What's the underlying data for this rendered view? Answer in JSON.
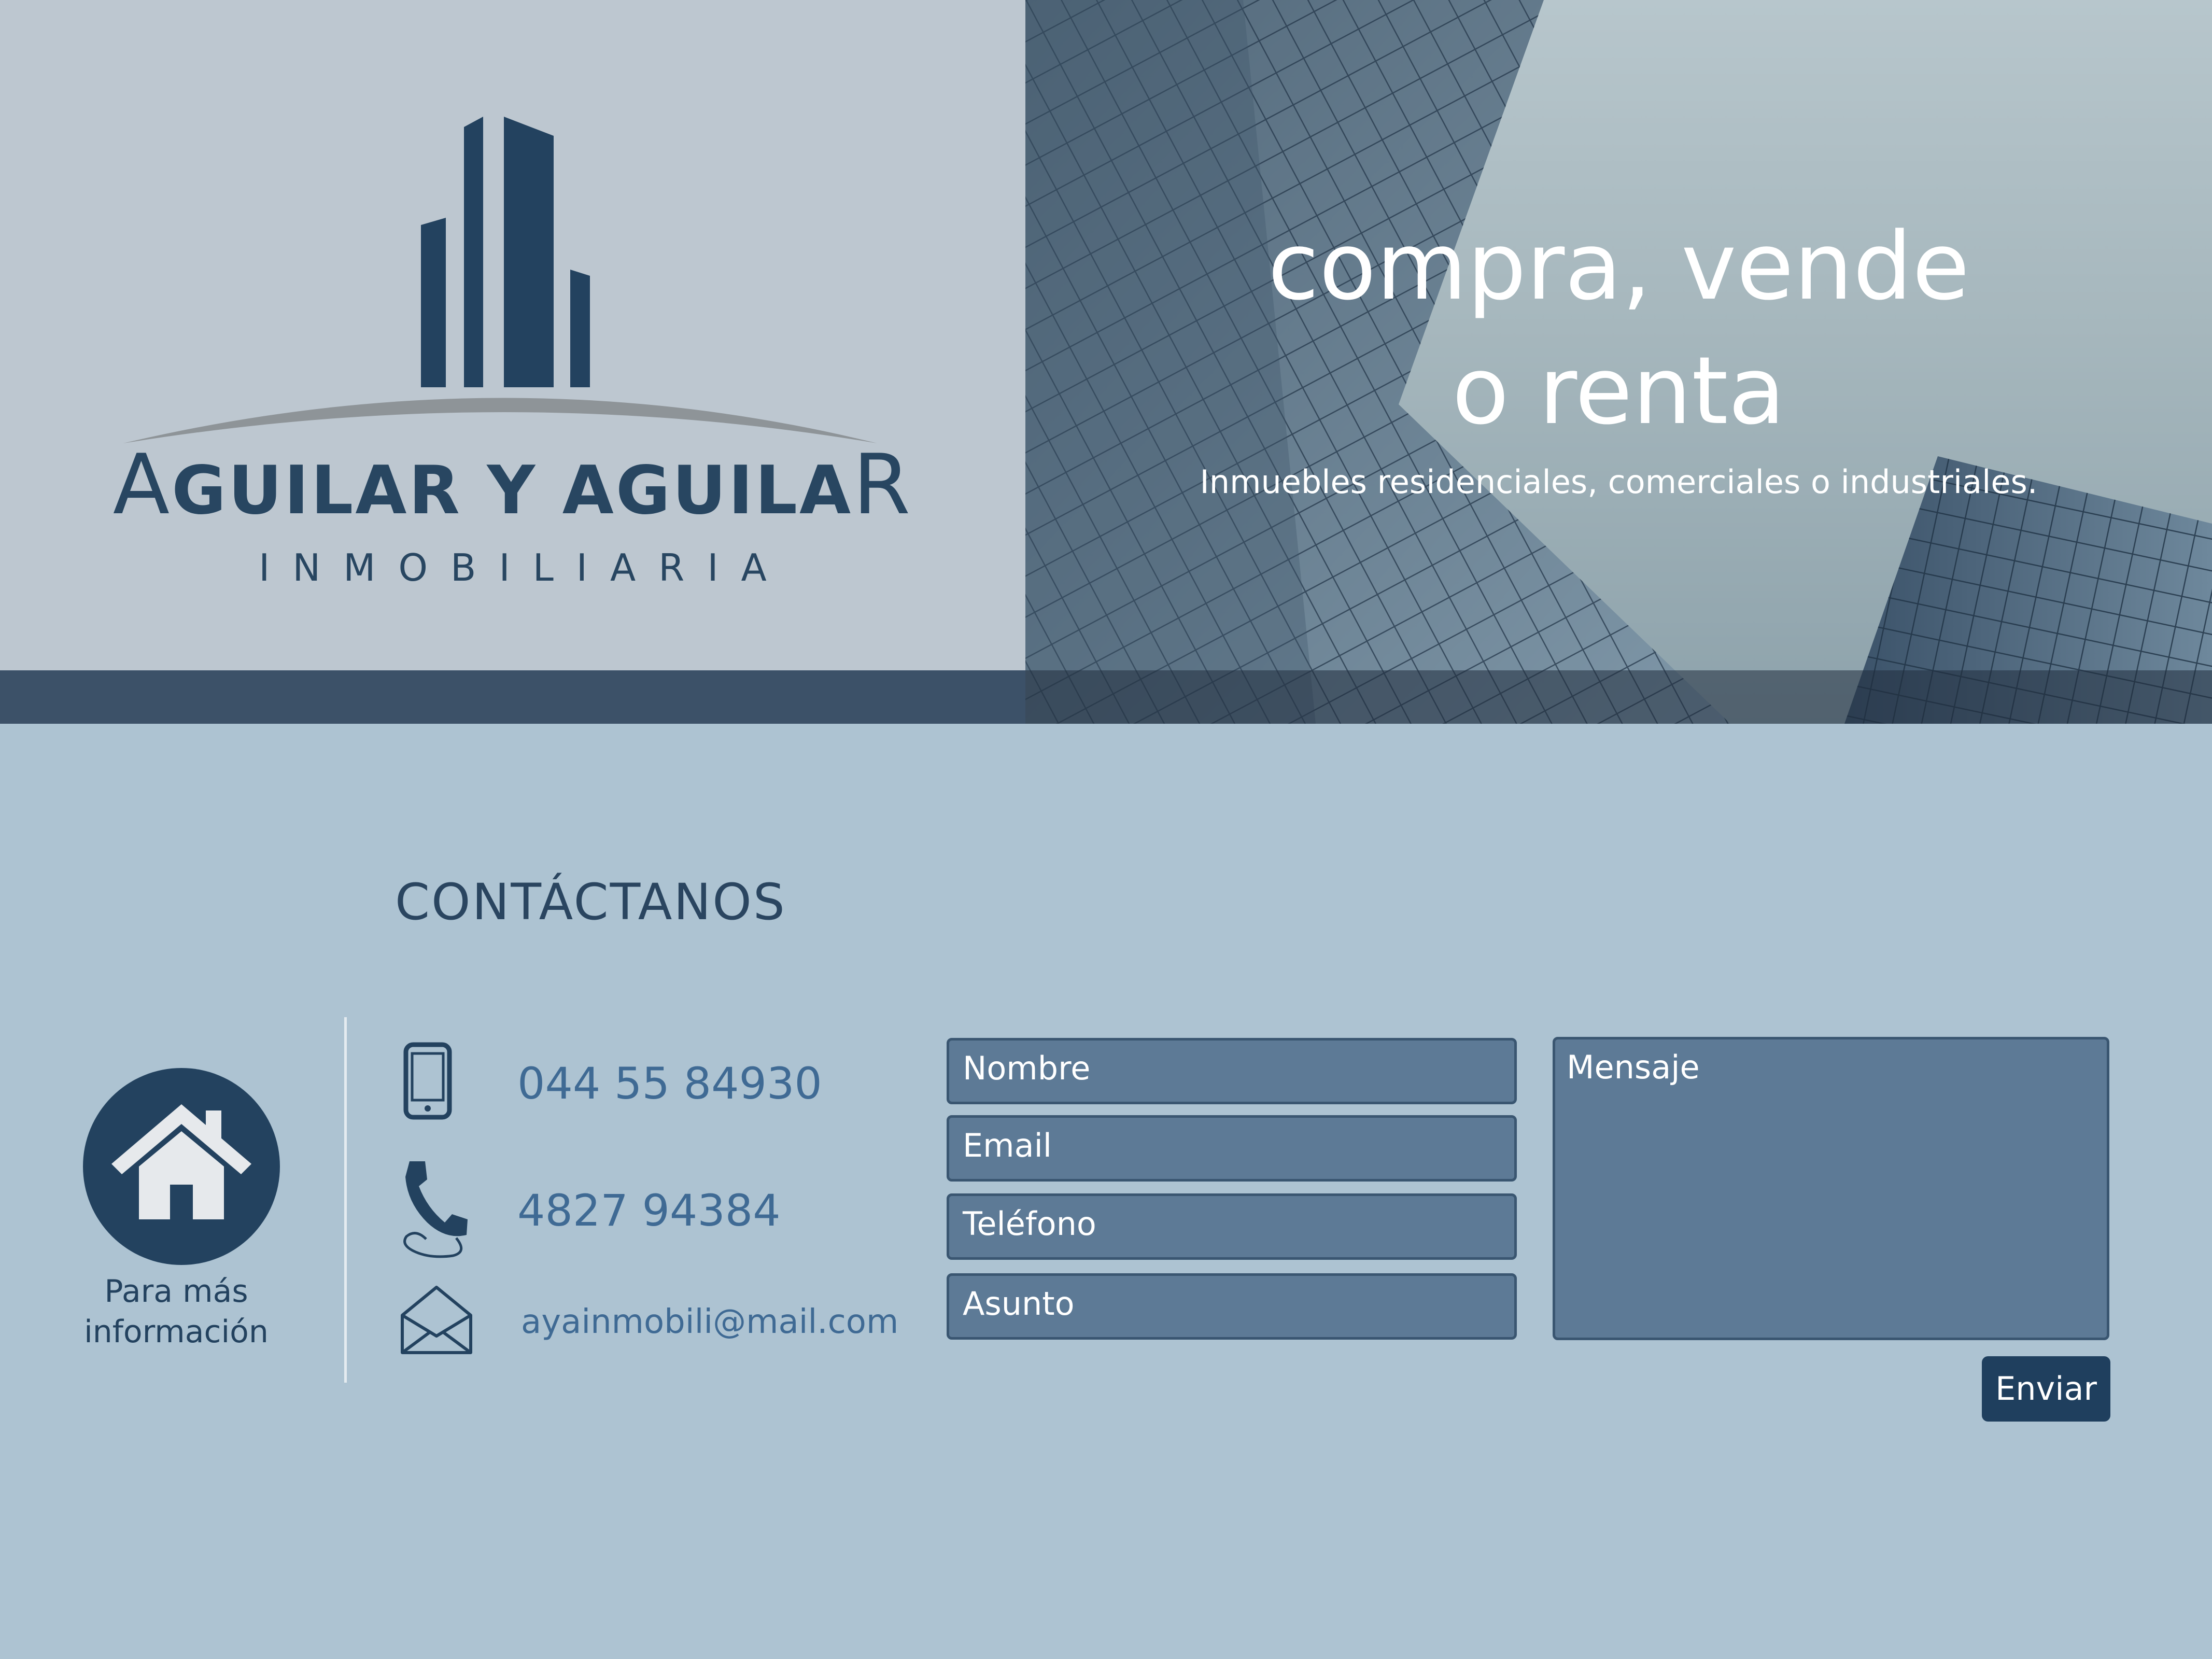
{
  "brand": {
    "name_lead": "A",
    "name_middle": "GUILAR Y AGUILA",
    "name_tail": "R",
    "tagline": "INMOBILIARIA"
  },
  "hero": {
    "headline_line1": "compra, vende",
    "headline_line2": "o renta",
    "subtitle": "Inmuebles residenciales, comerciales o industriales."
  },
  "contact": {
    "title": "CONTÁCTANOS",
    "info_caption_line1": "Para más",
    "info_caption_line2": "información",
    "mobile": "044 55 84930",
    "landline": "4827 94384",
    "email": "ayainmobili@mail.com"
  },
  "form": {
    "name_placeholder": "Nombre",
    "email_placeholder": "Email",
    "phone_placeholder": "Teléfono",
    "subject_placeholder": "Asunto",
    "message_placeholder": "Mensaje",
    "send_label": "Enviar"
  },
  "colors": {
    "navy": "#23425f",
    "page_background": "#adc3d2",
    "logo_background": "#bdc7d0",
    "field_fill": "#5d7a96",
    "link_text": "#3f6a94"
  },
  "icons": [
    "building-logo-icon",
    "home-icon",
    "mobile-phone-icon",
    "telephone-icon",
    "envelope-icon"
  ]
}
